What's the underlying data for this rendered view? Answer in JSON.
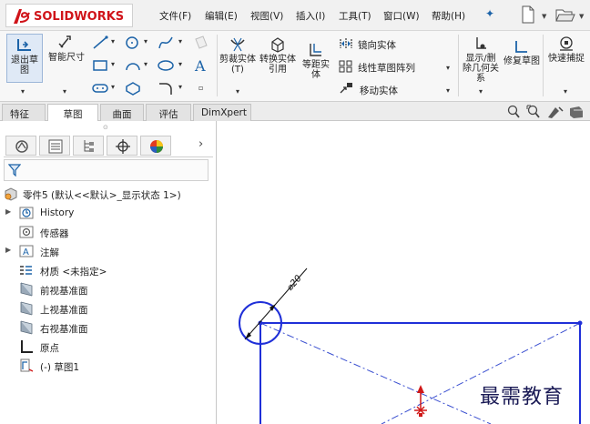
{
  "app": {
    "brand": "SOLIDWORKS",
    "brand_prefix": "DS",
    "brand_color": "#d0141a"
  },
  "menu": {
    "items": [
      "文件(F)",
      "编辑(E)",
      "视图(V)",
      "插入(I)",
      "工具(T)",
      "窗口(W)",
      "帮助(H)"
    ]
  },
  "toolbar": {
    "exit_sketch": "退出草图",
    "smart_dimension": "智能尺寸",
    "trim_entities": "剪裁实体(T)",
    "convert_entities": "转换实体引用",
    "offset_entities": "等距实体",
    "mirror_entities": "镜向实体",
    "linear_pattern": "线性草图阵列",
    "move_entities": "移动实体",
    "display_delete_relations": "显示/删除几何关系",
    "repair_sketch": "修复草图",
    "quick_snaps": "快速捕捉"
  },
  "tabs": [
    "特征",
    "草图",
    "曲面",
    "评估",
    "DimXpert"
  ],
  "active_tab": "草图",
  "tree": {
    "root": "零件5 (默认<<默认>_显示状态 1>)",
    "items": [
      "History",
      "传感器",
      "注解",
      "材质 <未指定>",
      "前视基准面",
      "上视基准面",
      "右视基准面",
      "原点",
      "(-) 草图1"
    ]
  },
  "sketch": {
    "dimension_label": "⌀20",
    "line_color": "#1f2fd8",
    "construction_color": "#3a4fd0",
    "origin_color": "#d01818"
  },
  "watermark": "最需教育",
  "colors": {
    "accent": "#1c63a8",
    "sketch_blue": "#1f2fd8",
    "toolbar_bg": "#f7f7f7"
  }
}
